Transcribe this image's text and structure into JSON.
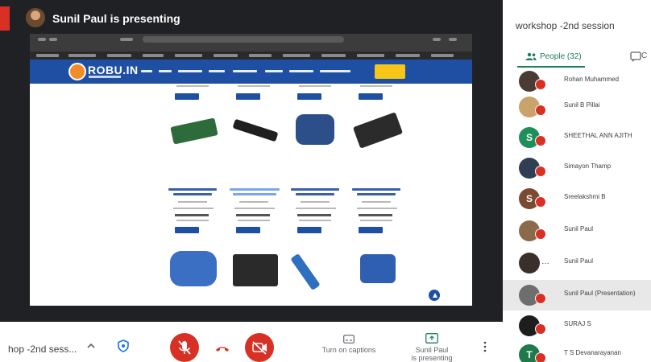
{
  "presenter": {
    "label": "Sunil Paul is presenting"
  },
  "shared_screen": {
    "site_logo": "ROBU.IN"
  },
  "controls": {
    "meeting_title": "hop -2nd sess...",
    "captions_label": "Turn on captions",
    "present_label_1": "Sunil Paul",
    "present_label_2": "is presenting",
    "mic_icon": "mic-off-icon",
    "hangup_icon": "hang-up-icon",
    "camera_icon": "camera-off-icon"
  },
  "side_panel": {
    "title": "workshop -2nd session",
    "people_tab": "People (32)",
    "chat_tab_cut": "C",
    "people": [
      {
        "name": "Rohan Muhammed",
        "initial": "",
        "color": "#4a3b33"
      },
      {
        "name": "Sunil B Pillai",
        "initial": "",
        "color": "#c9a36a"
      },
      {
        "name": "SHEETHAL ANN AJITH",
        "initial": "S",
        "color": "#1e8e5a"
      },
      {
        "name": "Simayon Thamp",
        "initial": "",
        "color": "#2f3e52"
      },
      {
        "name": "Sreelakshmi B",
        "initial": "S",
        "color": "#7a4a33"
      },
      {
        "name": "Sunil Paul",
        "initial": "",
        "color": "#8a6a4a"
      },
      {
        "name": "Sunil Paul",
        "initial": "",
        "color": "#3a2f2a"
      },
      {
        "name": "Sunil Paul (Presentation)",
        "initial": "",
        "color": "#6e6e6e"
      },
      {
        "name": "SURAJ S",
        "initial": "",
        "color": "#1d1d1d"
      },
      {
        "name": "T S Devanarayanan",
        "initial": "T",
        "color": "#1e7a4a"
      }
    ]
  },
  "colors": {
    "meet_red": "#d93025",
    "site_blue": "#1e4fa3",
    "people_green": "#1a7f5a"
  }
}
